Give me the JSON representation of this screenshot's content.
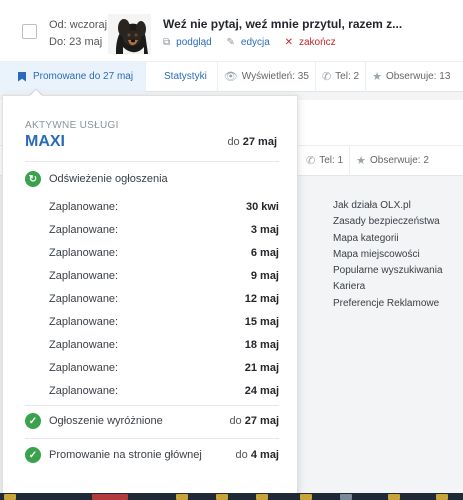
{
  "listing": {
    "from_label": "Od: wczoraj",
    "to_label": "Do: 23 maj",
    "title": "Weź nie pytaj, weź mnie przytul, razem z...",
    "actions": {
      "preview": "podgląd",
      "edit": "edycja",
      "end": "zakończ"
    },
    "stats": {
      "promoted": "Promowane do 27 maj",
      "statistics": "Statystyki",
      "views": "Wyświetleń: 35",
      "phone": "Tel: 2",
      "watchers": "Obserwuje: 13"
    }
  },
  "listing2": {
    "stats": {
      "phone": "Tel: 1",
      "watchers": "Obserwuje: 2"
    }
  },
  "footer_links": [
    "Jak działa OLX.pl",
    "Zasady bezpieczeństwa",
    "Mapa kategorii",
    "Mapa miejscowości",
    "Popularne wyszukiwania",
    "Kariera",
    "Preferencje Reklamowe"
  ],
  "popup": {
    "header": "AKTYWNE USŁUGI",
    "plan": "MAXI",
    "plan_until_prefix": "do",
    "plan_until_date": "27 maj",
    "refresh": {
      "label": "Odświeżenie ogłoszenia"
    },
    "scheduled_label": "Zaplanowane:",
    "schedule": [
      "30 kwi",
      "3 maj",
      "6 maj",
      "9 maj",
      "12 maj",
      "15 maj",
      "18 maj",
      "21 maj",
      "24 maj"
    ],
    "featured": {
      "label": "Ogłoszenie wyróżnione",
      "prefix": "do",
      "date": "27 maj"
    },
    "homepage": {
      "label": "Promowanie na stronie głównej",
      "prefix": "do",
      "date": "4 maj"
    }
  },
  "colors": {
    "accent": "#2a6bb8",
    "success": "#3aa24c",
    "danger": "#c3262b"
  }
}
